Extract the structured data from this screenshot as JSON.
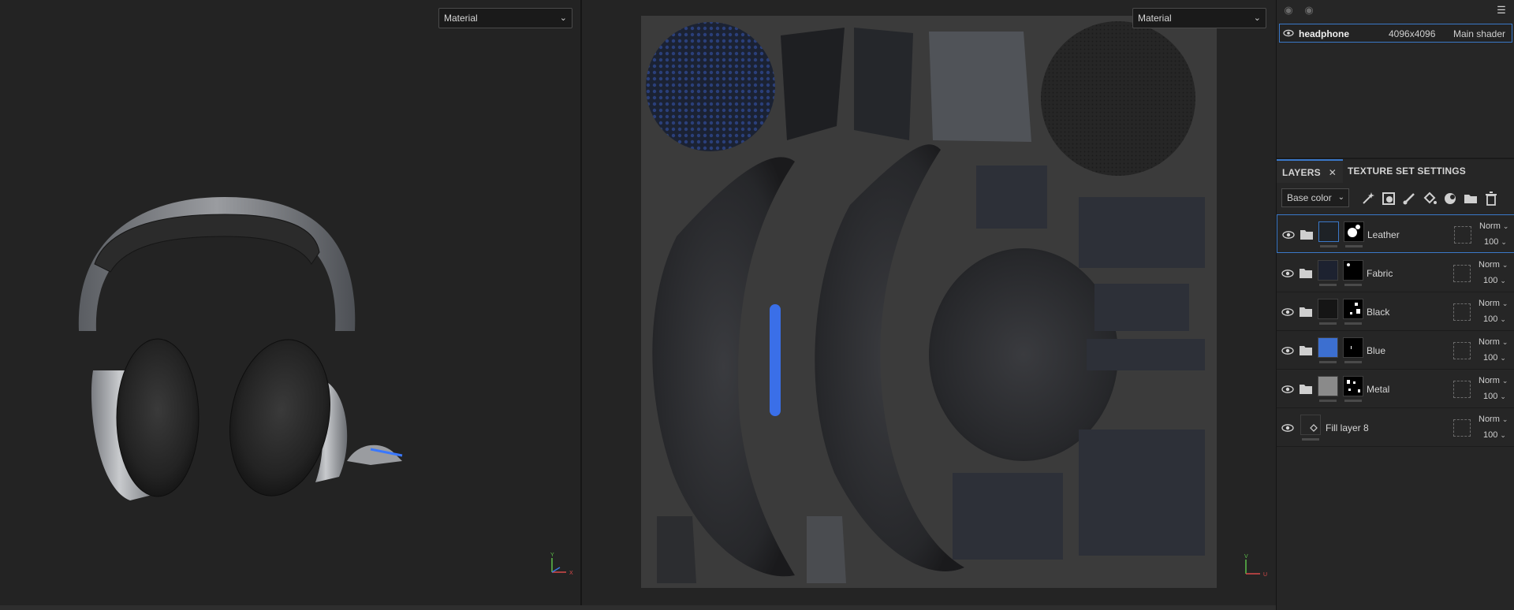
{
  "viewport3d": {
    "material_select": "Material"
  },
  "viewport2d": {
    "material_select": "Material"
  },
  "texture_set": {
    "name": "headphone",
    "size": "4096x4096",
    "shader": "Main shader"
  },
  "tabs": [
    {
      "label": "LAYERS"
    },
    {
      "label": "TEXTURE SET SETTINGS"
    }
  ],
  "tabs_close": "✕",
  "toolbar": {
    "channel": "Base color"
  },
  "layers": [
    {
      "name": "Leather",
      "blend": "Norm",
      "opacity": "100",
      "color": "#1e2226"
    },
    {
      "name": "Fabric",
      "blend": "Norm",
      "opacity": "100",
      "color": "#1d2230"
    },
    {
      "name": "Black",
      "blend": "Norm",
      "opacity": "100",
      "color": "#151515"
    },
    {
      "name": "Blue",
      "blend": "Norm",
      "opacity": "100",
      "color": "#3c6fd0"
    },
    {
      "name": "Metal",
      "blend": "Norm",
      "opacity": "100",
      "color": "#8a8a8a"
    },
    {
      "name": "Fill layer 8",
      "blend": "Norm",
      "opacity": "100",
      "color": "#262626"
    }
  ],
  "axes": {
    "x": "X",
    "y": "Y",
    "u": "U",
    "v": "V"
  }
}
